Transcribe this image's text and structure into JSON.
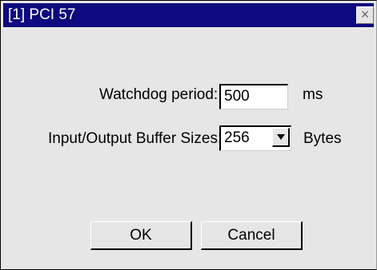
{
  "window": {
    "title": "[1] PCI 57",
    "close_symbol": "×"
  },
  "watchdog": {
    "label": "Watchdog period:",
    "value": "500",
    "unit": "ms"
  },
  "buffer": {
    "label": "Input/Output Buffer Sizes:",
    "selected_value": "256",
    "unit": "Bytes"
  },
  "buttons": {
    "ok": "OK",
    "cancel": "Cancel"
  },
  "icons": {
    "close": "close-icon",
    "dropdown": "chevron-down-icon"
  }
}
